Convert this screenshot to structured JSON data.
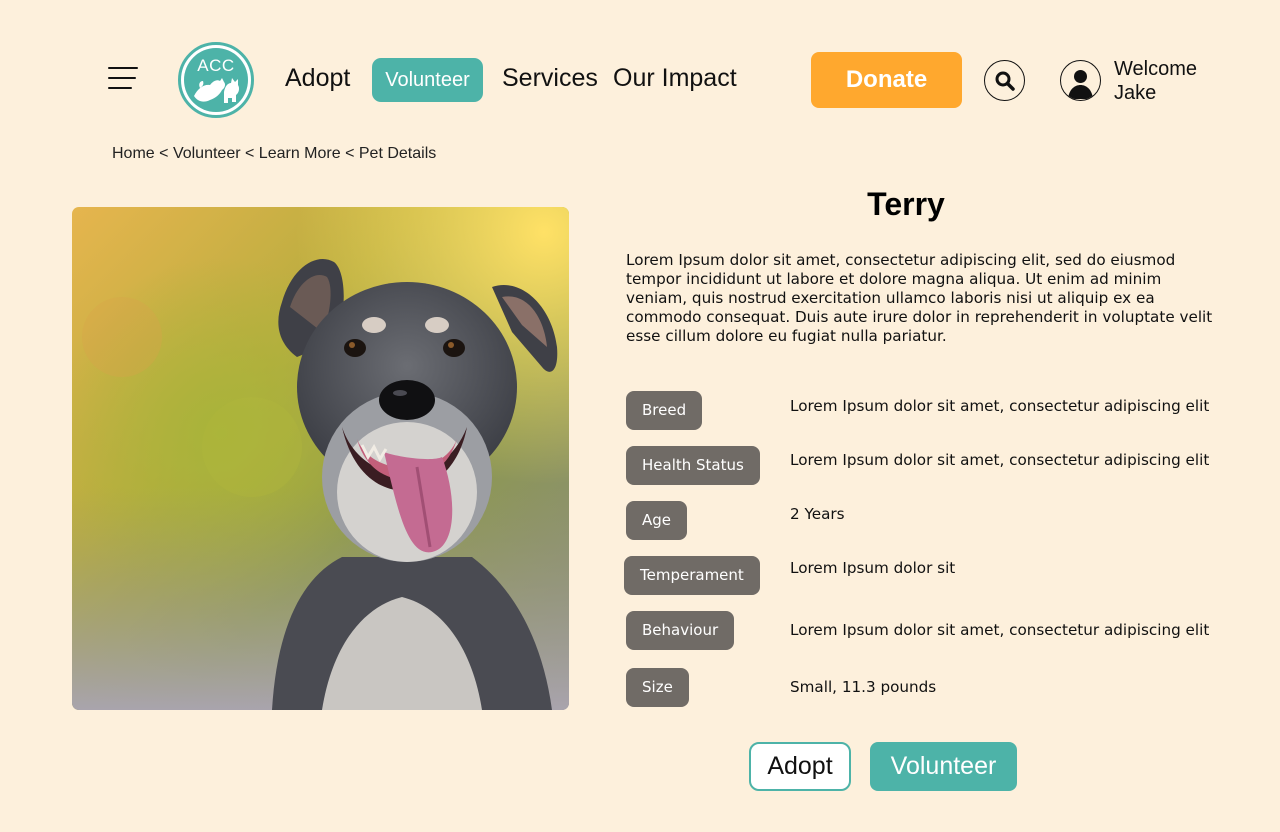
{
  "header": {
    "menu_icon": "hamburger-menu-icon",
    "logo": {
      "text": "ACC",
      "color": "#4db3a8"
    },
    "nav": {
      "adopt": "Adopt",
      "volunteer": "Volunteer",
      "services": "Services",
      "our_impact": "Our Impact"
    },
    "donate_label": "Donate",
    "search_icon": "search-icon",
    "user": {
      "avatar_icon": "user-avatar-icon",
      "welcome_line1": "Welcome",
      "welcome_line2": "Jake"
    }
  },
  "breadcrumb": {
    "items": [
      "Home",
      "Volunteer",
      "Learn More",
      "Pet Details"
    ],
    "separator": "<"
  },
  "pet": {
    "name": "Terry",
    "description": "Lorem Ipsum dolor sit amet, consectetur adipiscing elit, sed do eiusmod tempor incididunt ut labore et dolore magna aliqua. Ut enim ad minim veniam, quis nostrud exercitation ullamco laboris nisi ut aliquip ex ea commodo consequat. Duis aute irure dolor in reprehenderit in voluptate velit esse cillum dolore eu fugiat nulla pariatur.",
    "details": [
      {
        "label": "Breed",
        "value": "Lorem Ipsum dolor sit amet, consectetur adipiscing elit"
      },
      {
        "label": "Health Status",
        "value": "Lorem Ipsum dolor sit amet, consectetur adipiscing elit"
      },
      {
        "label": "Age",
        "value": "2 Years"
      },
      {
        "label": "Temperament",
        "value": "Lorem Ipsum dolor sit"
      },
      {
        "label": "Behaviour",
        "value": "Lorem Ipsum dolor sit amet, consectetur adipiscing elit"
      },
      {
        "label": "Size",
        "value": "Small, 11.3 pounds"
      }
    ]
  },
  "actions": {
    "adopt": "Adopt",
    "volunteer": "Volunteer"
  },
  "colors": {
    "background": "#fdf0dc",
    "teal": "#4db3a8",
    "donate": "#ffa82e",
    "chip": "#706b66"
  }
}
